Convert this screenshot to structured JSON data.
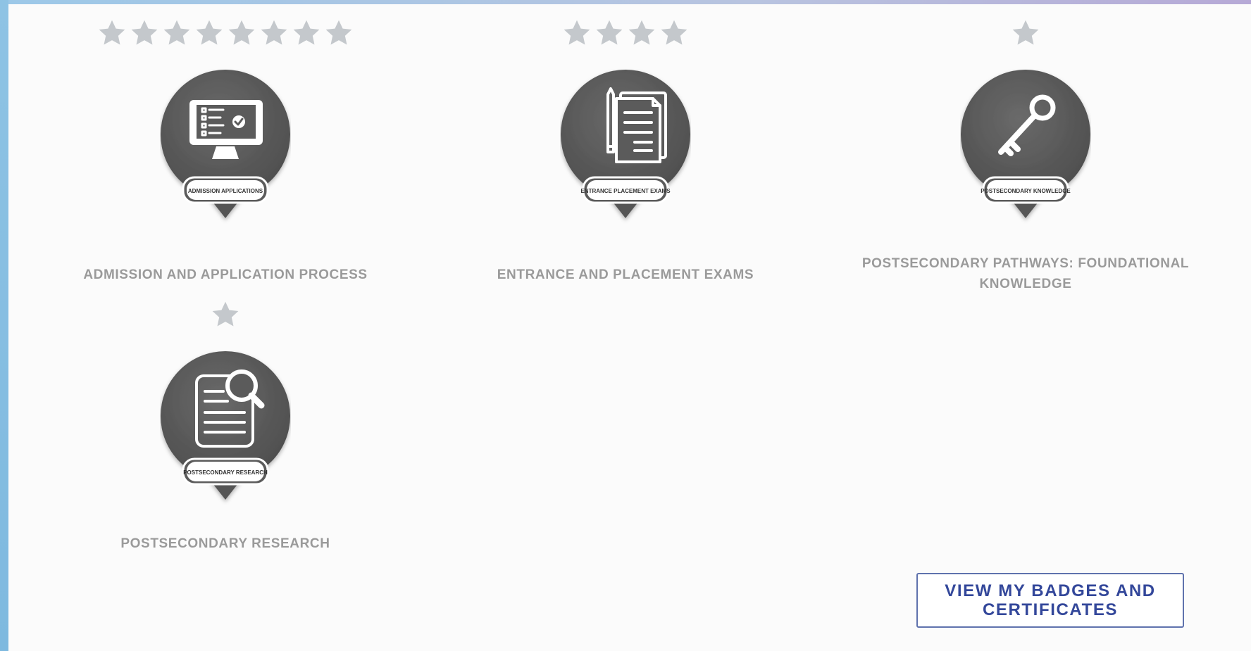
{
  "badges": [
    {
      "title": "ADMISSION AND APPLICATION PROCESS",
      "pin_label": "ADMISSION APPLICATIONS",
      "stars": 8,
      "icon": "monitor-checklist-icon"
    },
    {
      "title": "ENTRANCE AND PLACEMENT EXAMS",
      "pin_label": "ENTRANCE PLACEMENT EXAMS",
      "stars": 4,
      "icon": "documents-pencil-icon"
    },
    {
      "title": "POSTSECONDARY PATHWAYS: FOUNDATIONAL KNOWLEDGE",
      "pin_label": "POSTSECONDARY KNOWLEDGE",
      "stars": 1,
      "icon": "key-icon"
    },
    {
      "title": "POSTSECONDARY RESEARCH",
      "pin_label": "POSTSECONDARY RESEARCH",
      "stars": 1,
      "icon": "document-magnifier-icon"
    }
  ],
  "cta": {
    "label": "VIEW MY BADGES AND CERTIFICATES"
  },
  "colors": {
    "star": "#c4c8cc",
    "pin": "#5b5b5b",
    "title": "#9a9a9a",
    "cta_border": "#5f72ad",
    "cta_text": "#33479a"
  }
}
